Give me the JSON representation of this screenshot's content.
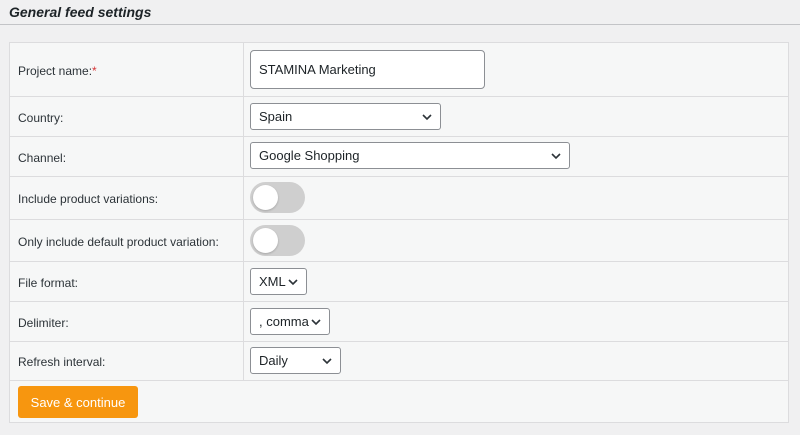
{
  "header": {
    "title": "General feed settings"
  },
  "form": {
    "project_name": {
      "label": "Project name:",
      "required_mark": "*",
      "value": "STAMINA Marketing"
    },
    "country": {
      "label": "Country:",
      "value": "Spain"
    },
    "channel": {
      "label": "Channel:",
      "value": "Google Shopping"
    },
    "include_variations": {
      "label": "Include product variations:",
      "enabled": false
    },
    "default_variation": {
      "label": "Only include default product variation:",
      "enabled": false
    },
    "file_format": {
      "label": "File format:",
      "value": "XML"
    },
    "delimiter": {
      "label": "Delimiter:",
      "value": ", comma"
    },
    "refresh_interval": {
      "label": "Refresh interval:",
      "value": "Daily"
    },
    "submit_label": "Save & continue"
  },
  "colors": {
    "accent_button": "#f7960f",
    "required": "#d63638",
    "toggle_off": "#cfcfcf"
  },
  "icons": [
    "chevron-down-icon"
  ]
}
